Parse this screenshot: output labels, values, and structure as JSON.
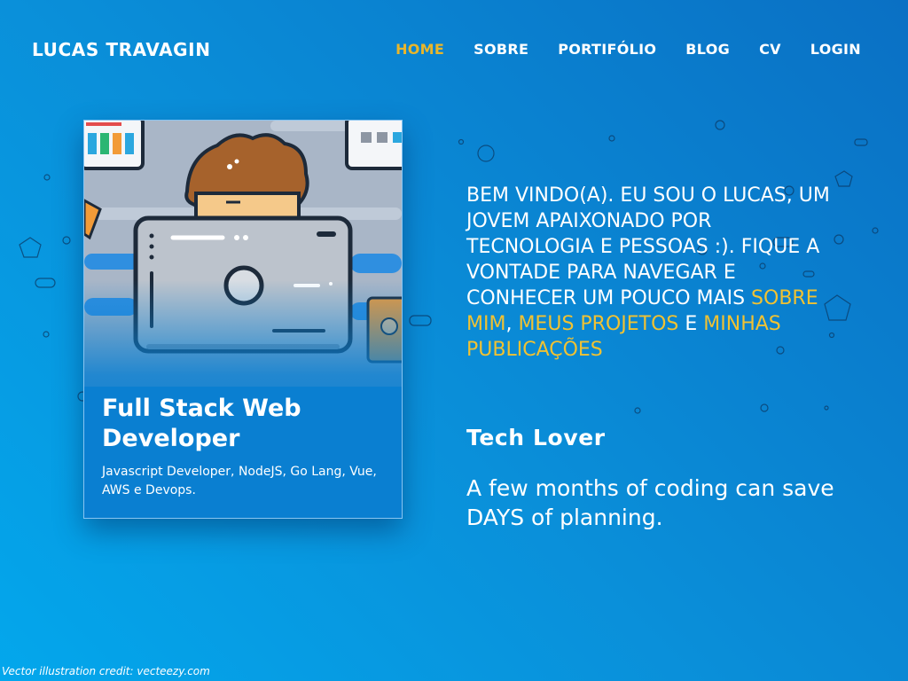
{
  "brand": "LUCAS TRAVAGIN",
  "nav": [
    {
      "label": "HOME",
      "active": true
    },
    {
      "label": "SOBRE",
      "active": false
    },
    {
      "label": "PORTIFÓLIO",
      "active": false
    },
    {
      "label": "BLOG",
      "active": false
    },
    {
      "label": "CV",
      "active": false
    },
    {
      "label": "LOGIN",
      "active": false
    }
  ],
  "card": {
    "title": "Full Stack Web Developer",
    "description": "Javascript Developer, NodeJS, Go Lang, Vue, AWS e Devops.",
    "illustration_icon": "developer-with-laptop-illustration"
  },
  "intro": {
    "text_before": "Bem vindo(a). Eu sou o Lucas, um jovem apaixonado por tecnologia e pessoas :). Fique a vontade para navegar e conhecer um pouco mais ",
    "link_about": "sobre mim",
    "sep1": ", ",
    "link_projects": "meus projetos",
    "sep2": " e ",
    "link_posts": "minhas publicações"
  },
  "tagline": "Tech Lover",
  "quote": "A few months of coding can save DAYS of planning.",
  "credit": "Vector illustration credit: vecteezy.com",
  "colors": {
    "accent": "#e9b62a",
    "link": "#f1c232",
    "background_start": "#03a7ec",
    "background_end": "#0a70c4"
  }
}
